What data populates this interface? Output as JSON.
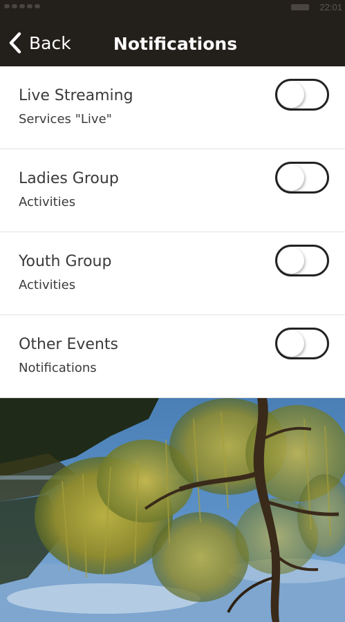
{
  "status_bar": {
    "time": "22:01"
  },
  "nav": {
    "back_label": "Back",
    "title": "Notifications"
  },
  "items": [
    {
      "title": "Live Streaming",
      "subtitle": "Services \"Live\"",
      "enabled": false
    },
    {
      "title": "Ladies Group",
      "subtitle": "Activities",
      "enabled": false
    },
    {
      "title": "Youth Group",
      "subtitle": "Activities",
      "enabled": false
    },
    {
      "title": "Other Events",
      "subtitle": "Notifications",
      "enabled": false
    }
  ],
  "colors": {
    "header_background": "#231f1b",
    "toggle_border": "#222222",
    "text": "#3a3a3a"
  },
  "icons": {
    "back": "chevron-left-icon"
  }
}
